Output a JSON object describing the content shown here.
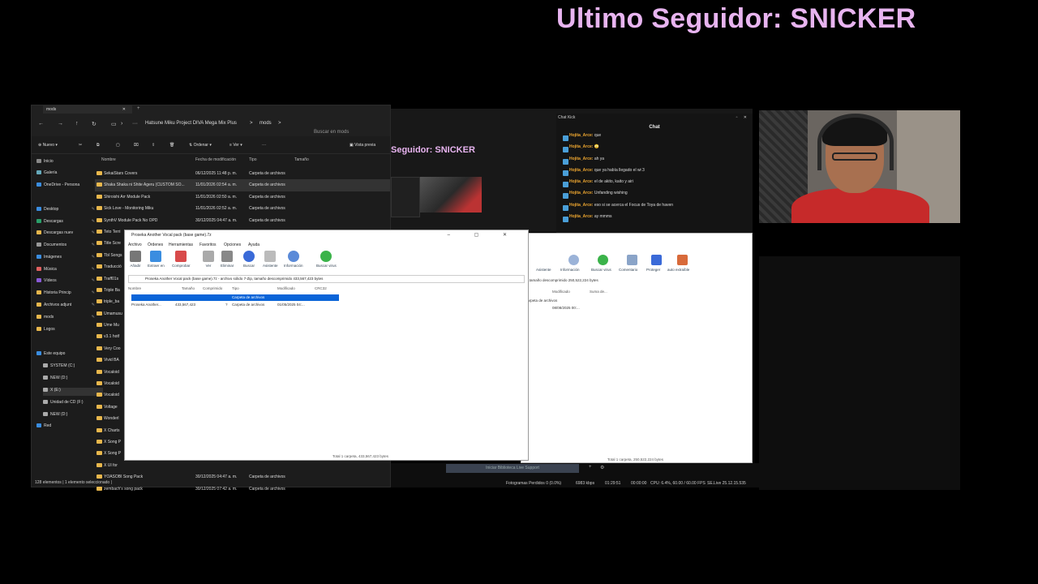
{
  "overlay": {
    "title": "Ultimo Seguidor: SNICKER"
  },
  "explorer": {
    "tab_label": "mods",
    "path": [
      "Hatsune Miku Project DIVA Mega Mix Plus",
      ">",
      "mods",
      ">"
    ],
    "search_placeholder": "Buscar en mods",
    "toolbar": {
      "new": "Nuevo",
      "sort": "Ordenar",
      "view": "Ver",
      "more": "···",
      "preview": "Vista previa"
    },
    "nav": [
      "Inicio",
      "Galería",
      "OneDrive - Persona",
      "Desktop",
      "Descargas",
      "Descargas nuev",
      "Documentos",
      "Imágenes",
      "Música",
      "Vídeos",
      "Historia Princip",
      "Archivos adjunt",
      "mods",
      "Logos",
      "Este equipo",
      "SYSTEM (C:)",
      "NEW (D:)",
      "X (E:)",
      "Unidad de CD (F:)",
      "NEW (D:)",
      "Red"
    ],
    "columns": [
      "Nombre",
      "Fecha de modificación",
      "Tipo",
      "Tamaño"
    ],
    "rows": [
      {
        "name": "SekaiStars Covers",
        "date": "06/12/2025 11:48 p. m.",
        "type": "Carpeta de archivos"
      },
      {
        "name": "Shaka Shaka ni Shite Ageru (CUSTOM SO...",
        "date": "11/01/2026 02:54 a. m.",
        "type": "Carpeta de archivos"
      },
      {
        "name": "Shiroishi Arr Module Pack",
        "date": "11/01/2026 02:50 a. m.",
        "type": "Carpeta de archivos"
      },
      {
        "name": "Sick Love - Monitoring Miku",
        "date": "11/01/2026 02:52 a. m.",
        "type": "Carpeta de archivos"
      },
      {
        "name": "SynthV Module Pack No OPD",
        "date": "30/12/2025 04:47 a. m.",
        "type": "Carpeta de archivos"
      },
      {
        "name": "Teto Terri",
        "date": "",
        "type": ""
      },
      {
        "name": "Title Scre",
        "date": "",
        "type": ""
      },
      {
        "name": "Tbl Songs",
        "date": "",
        "type": ""
      },
      {
        "name": "Traducció",
        "date": "",
        "type": ""
      },
      {
        "name": "Traff01s",
        "date": "",
        "type": ""
      },
      {
        "name": "Triple Ba",
        "date": "",
        "type": ""
      },
      {
        "name": "triple_ba",
        "date": "",
        "type": ""
      },
      {
        "name": "Umamusu",
        "date": "",
        "type": ""
      },
      {
        "name": "Ume Mu",
        "date": "",
        "type": ""
      },
      {
        "name": "v3.1 hotf",
        "date": "",
        "type": ""
      },
      {
        "name": "Very Coo",
        "date": "",
        "type": ""
      },
      {
        "name": "Vivid BA",
        "date": "",
        "type": ""
      },
      {
        "name": "Vocaloid",
        "date": "",
        "type": ""
      },
      {
        "name": "Vocaloid",
        "date": "",
        "type": ""
      },
      {
        "name": "Vocaloid",
        "date": "",
        "type": ""
      },
      {
        "name": "Voltage",
        "date": "",
        "type": ""
      },
      {
        "name": "Wonderl",
        "date": "",
        "type": ""
      },
      {
        "name": "X Charts",
        "date": "",
        "type": ""
      },
      {
        "name": "X Song P",
        "date": "",
        "type": ""
      },
      {
        "name": "X Song P",
        "date": "",
        "type": ""
      },
      {
        "name": "X UI for",
        "date": "",
        "type": ""
      },
      {
        "name": "YOASOBI Song Pack",
        "date": "30/12/2025 04:47 a. m.",
        "type": "Carpeta de archivos"
      },
      {
        "name": "zembach's song pack",
        "date": "30/12/2025 07:42 a. m.",
        "type": "Carpeta de archivos"
      }
    ],
    "status": "128 elementos  |  1 elemento seleccionado  |"
  },
  "obs": {
    "preview_title": "Seguidor: SNICKER",
    "button": "Iniciar Biblioteca Live Support",
    "stats": [
      "Fotogramas Perdidos 0 (0.0%)",
      "6983 kbps",
      "01:29:51",
      "00:00:00",
      "CPU: 6.4%, 60.00 / 60.00 FPS"
    ],
    "rec": "SE.Live 25.12.15.535"
  },
  "chat": {
    "window_title": "Chat Kick",
    "header": "Chat",
    "messages": [
      {
        "user": "Hojita_Arce:",
        "text": " que"
      },
      {
        "user": "Hojita_Arce:",
        "text": " 😳"
      },
      {
        "user": "Hojita_Arce:",
        "text": " ah ya"
      },
      {
        "user": "Hojita_Arce:",
        "text": " que ya había llegado el wi 3"
      },
      {
        "user": "Hojita_Arce:",
        "text": " el de akito, kaito y airi"
      },
      {
        "user": "Hojita_Arce:",
        "text": " Unfanding wishing"
      },
      {
        "user": "Hojita_Arce:",
        "text": " eso si se acerca el Focus de Toya de haven"
      },
      {
        "user": "Hojita_Arce:",
        "text": " ay mmms"
      }
    ]
  },
  "zip_back": {
    "tools": [
      "Asistente",
      "Información",
      "Buscar virus",
      "Comentario",
      "Proteger",
      "auto extraíble"
    ],
    "info": "...tamaño descomprimido 250,522,224 bytes",
    "columns": [
      "Modificado",
      "Suma de..."
    ],
    "row": {
      "type": "Carpeta de archivos",
      "date": "08/08/2025 00:..."
    },
    "status": "Total 1 carpeta, 250,522,224 bytes"
  },
  "zip_front": {
    "title": "Proseka Another Vocal pack (base game).7z",
    "menu": [
      "Archivo",
      "Órdenes",
      "Herramientas",
      "Favoritos",
      "Opciones",
      "Ayuda"
    ],
    "tools": [
      "Añadir",
      "Extraer en",
      "Comprobar",
      "Ver",
      "Eliminar",
      "Buscar",
      "Asistente",
      "Información",
      "Buscar virus"
    ],
    "address": "Proseka Another Vocal pack (base game).7z - archivo sólido 7-Zip, tamaño descomprimido 433,567,423 bytes",
    "columns": [
      "Nombre",
      "Tamaño",
      "Comprimido",
      "Tipo",
      "Modificado",
      "CRC32"
    ],
    "selected": "Carpeta de archivos",
    "row": {
      "name": "Proseka Another...",
      "size": "433,567,423",
      "packed": "?",
      "type": "Carpeta de archivos",
      "date": "01/05/2025 04:..."
    },
    "status": "Total 1 carpeta, 433,567,423 bytes"
  }
}
